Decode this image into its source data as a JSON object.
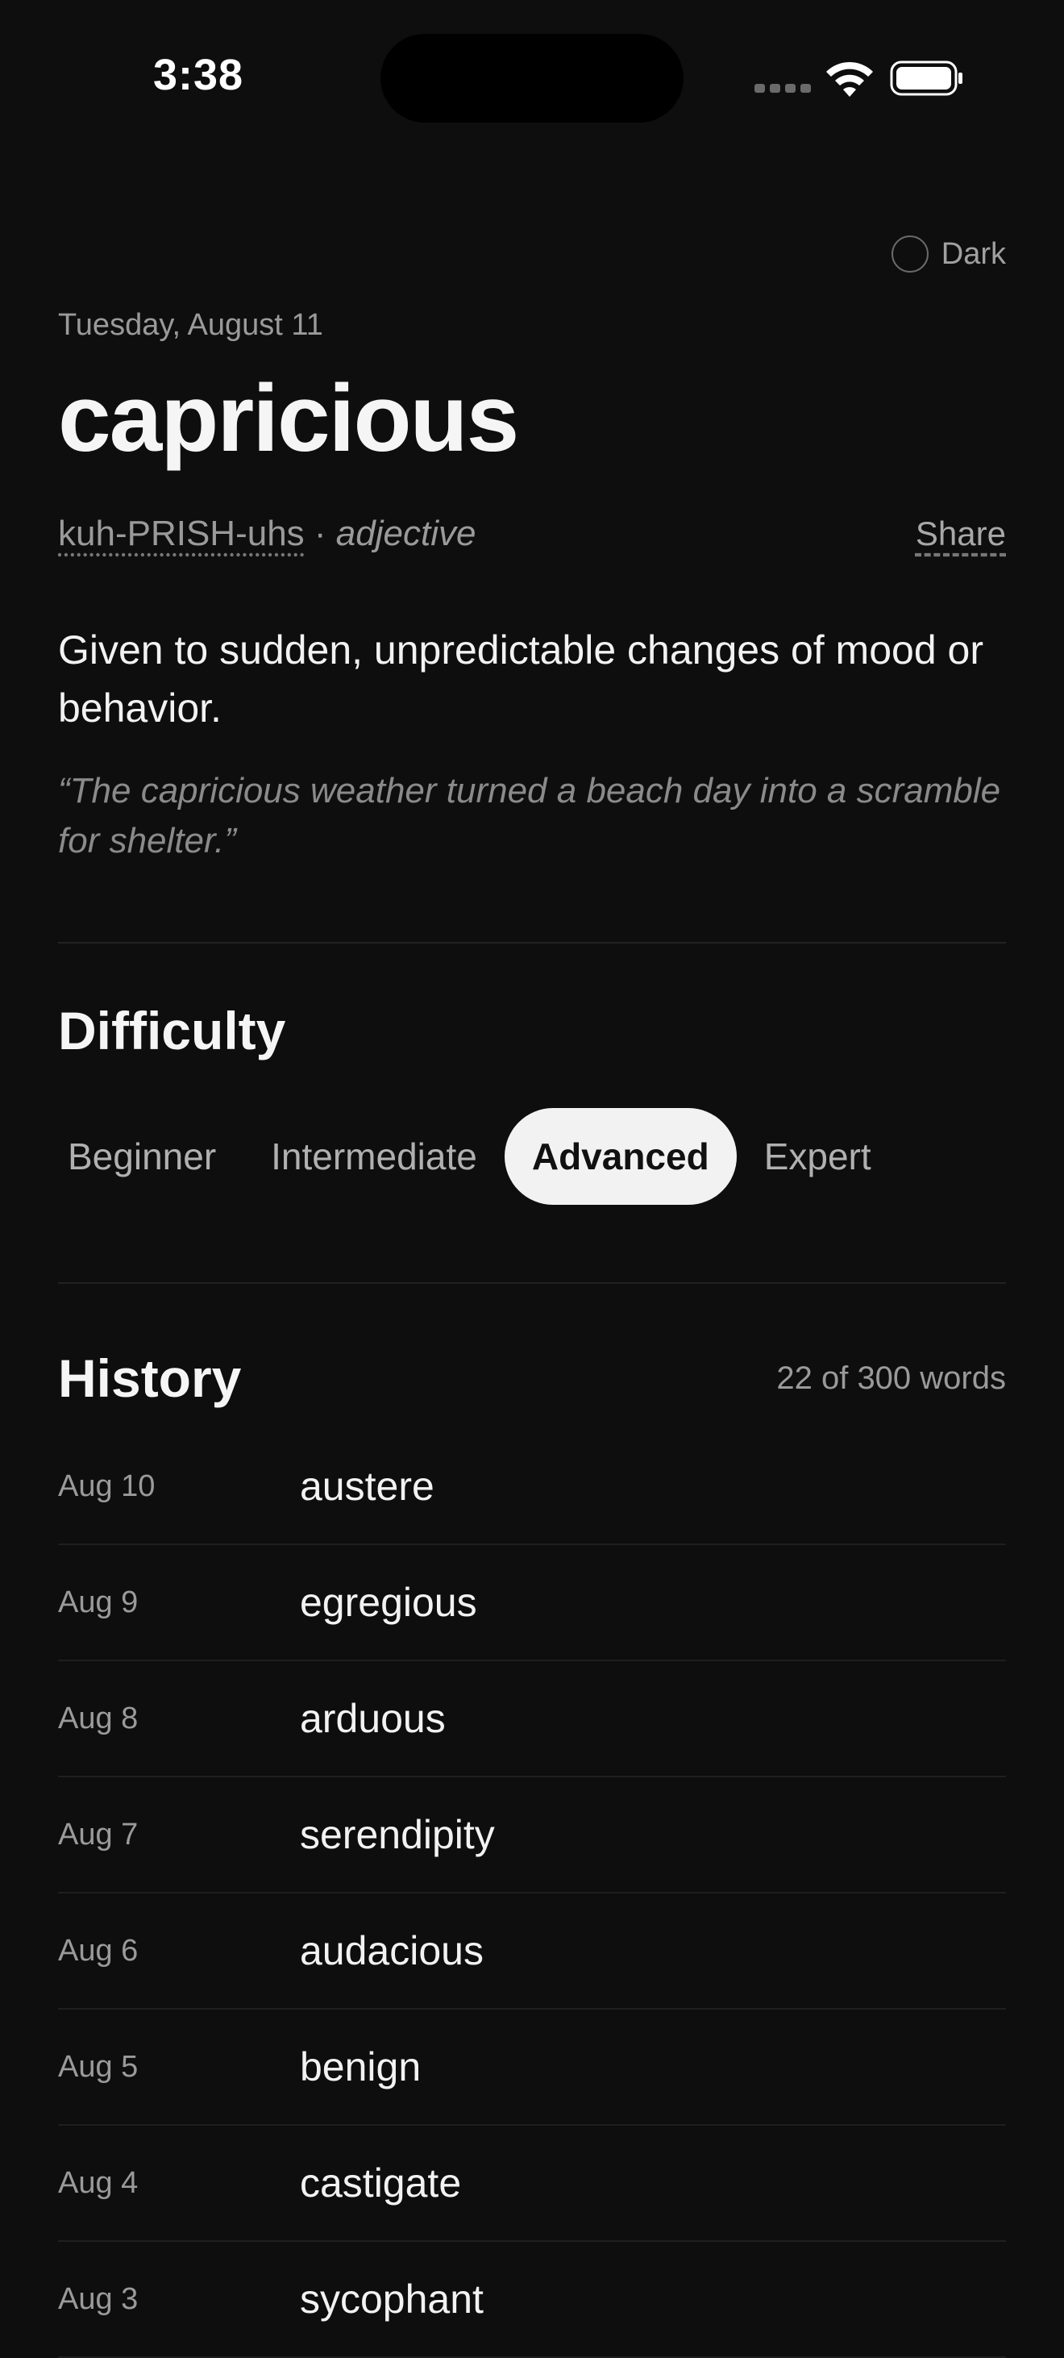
{
  "status": {
    "time": "3:38"
  },
  "theme": {
    "label": "Dark"
  },
  "today": {
    "date": "Tuesday, August 11",
    "word": "capricious",
    "pronunciation": "kuh-PRISH-uhs",
    "separator": " · ",
    "part_of_speech": "adjective",
    "share_label": "Share",
    "definition": "Given to sudden, unpredictable changes of mood or behavior.",
    "example": "“The capricious weather turned a beach day into a scramble for shelter.”"
  },
  "difficulty": {
    "title": "Difficulty",
    "options": [
      "Beginner",
      "Intermediate",
      "Advanced",
      "Expert"
    ],
    "selected": "Advanced"
  },
  "history": {
    "title": "History",
    "count": "22 of 300 words",
    "items": [
      {
        "date": "Aug 10",
        "word": "austere"
      },
      {
        "date": "Aug 9",
        "word": "egregious"
      },
      {
        "date": "Aug 8",
        "word": "arduous"
      },
      {
        "date": "Aug 7",
        "word": "serendipity"
      },
      {
        "date": "Aug 6",
        "word": "audacious"
      },
      {
        "date": "Aug 5",
        "word": "benign"
      },
      {
        "date": "Aug 4",
        "word": "castigate"
      },
      {
        "date": "Aug 3",
        "word": "sycophant"
      }
    ]
  }
}
